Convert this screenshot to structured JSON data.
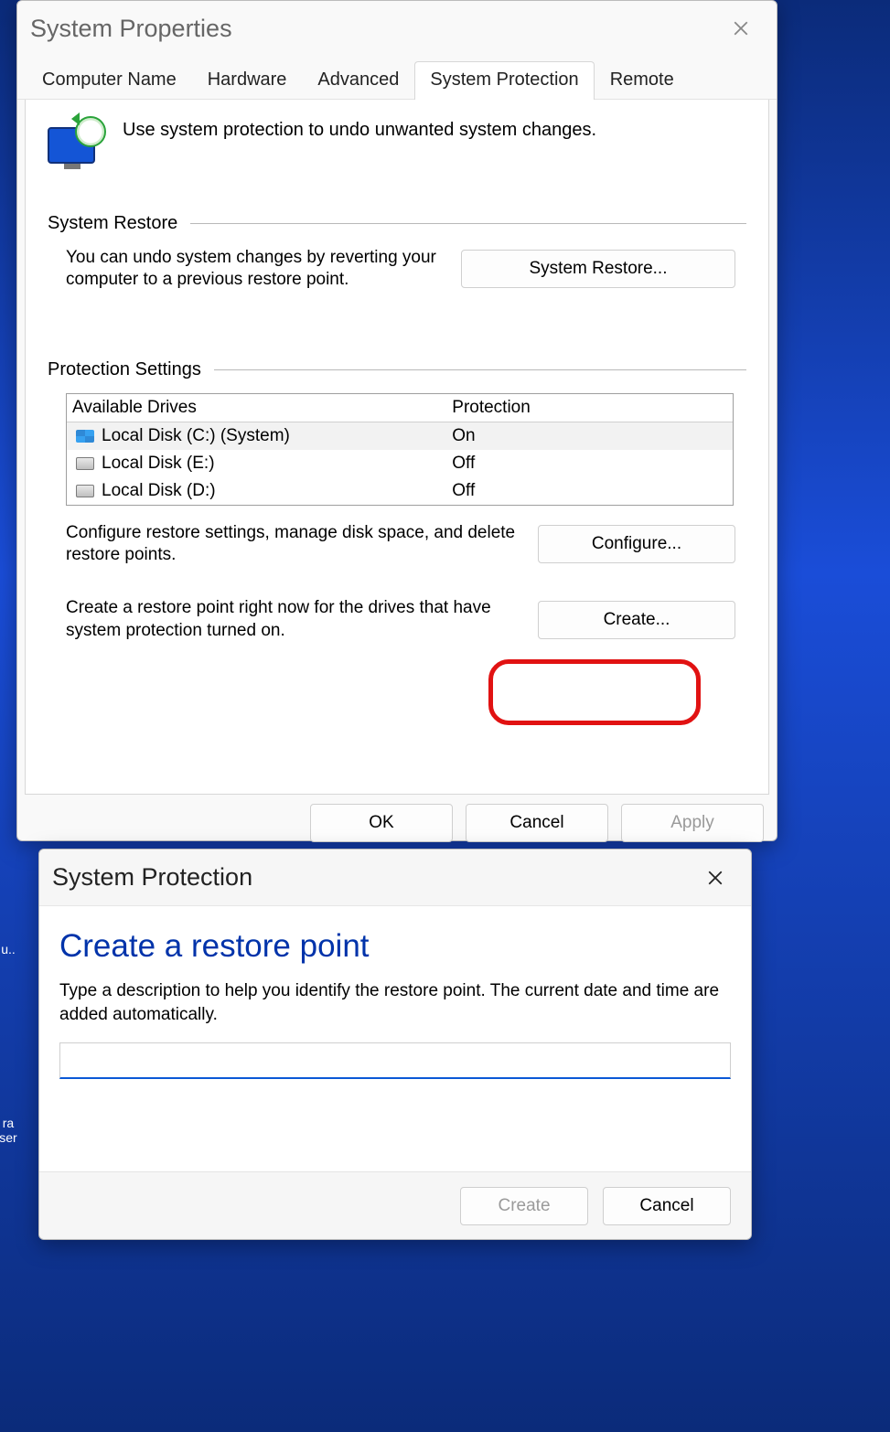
{
  "sys_props": {
    "title": "System Properties",
    "tabs": [
      {
        "label": "Computer Name"
      },
      {
        "label": "Hardware"
      },
      {
        "label": "Advanced"
      },
      {
        "label": "System Protection"
      },
      {
        "label": "Remote"
      }
    ],
    "active_tab": 3,
    "intro": "Use system protection to undo unwanted system changes.",
    "restore_section": {
      "title": "System Restore",
      "text": "You can undo system changes by reverting your computer to a previous restore point.",
      "button": "System Restore..."
    },
    "settings_section": {
      "title": "Protection Settings",
      "col_drive": "Available Drives",
      "col_prot": "Protection",
      "drives": [
        {
          "name": "Local Disk (C:) (System)",
          "protection": "On",
          "system": true
        },
        {
          "name": "Local Disk (E:)",
          "protection": "Off",
          "system": false
        },
        {
          "name": "Local Disk (D:)",
          "protection": "Off",
          "system": false
        }
      ],
      "configure_text": "Configure restore settings, manage disk space, and delete restore points.",
      "configure_button": "Configure...",
      "create_text": "Create a restore point right now for the drives that have system protection turned on.",
      "create_button": "Create..."
    },
    "buttons": {
      "ok": "OK",
      "cancel": "Cancel",
      "apply": "Apply"
    }
  },
  "sys_prot": {
    "title": "System Protection",
    "heading": "Create a restore point",
    "desc": "Type a description to help you identify the restore point. The current date and time are added automatically.",
    "input_value": "",
    "buttons": {
      "create": "Create",
      "cancel": "Cancel"
    }
  }
}
